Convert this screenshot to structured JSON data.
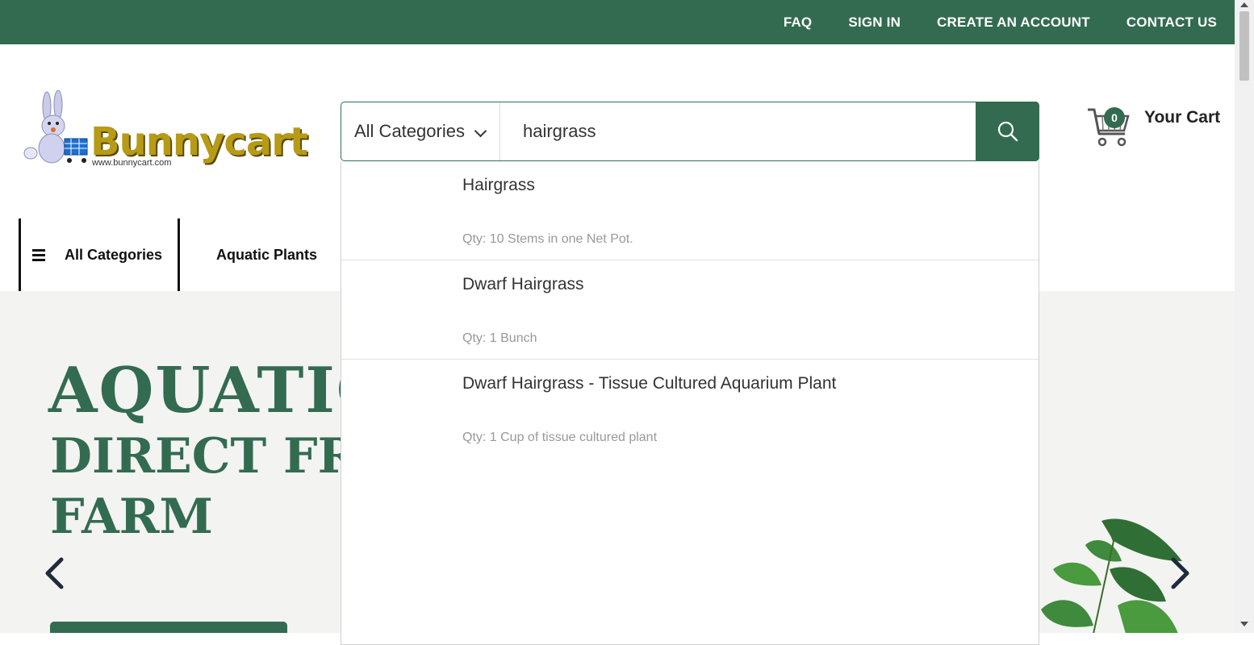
{
  "topbar": {
    "links": [
      "FAQ",
      "SIGN IN",
      "CREATE AN ACCOUNT",
      "CONTACT US"
    ]
  },
  "logo": {
    "name": "Bunnycart",
    "url": "www.bunnycart.com"
  },
  "search": {
    "category": "All Categories",
    "query": "hairgrass",
    "icon": "search-icon"
  },
  "cart": {
    "count": "0",
    "label": "Your Cart"
  },
  "nav": {
    "all_categories": "All Categories",
    "aquatic_plants": "Aquatic Plants"
  },
  "hero": {
    "line1": "AQUATIC",
    "line2": "DIRECT FRO",
    "line3": "FARM"
  },
  "suggestions": [
    {
      "name": "Hairgrass",
      "qty": "Qty: 10 Stems in one Net Pot."
    },
    {
      "name": "Dwarf Hairgrass",
      "qty": "Qty: 1 Bunch"
    },
    {
      "name": "Dwarf Hairgrass - Tissue Cultured Aquarium Plant",
      "qty": "Qty: 1 Cup of tissue cultured plant"
    }
  ],
  "colors": {
    "brand_green": "#336b50",
    "logo_gold": "#b79a16"
  }
}
